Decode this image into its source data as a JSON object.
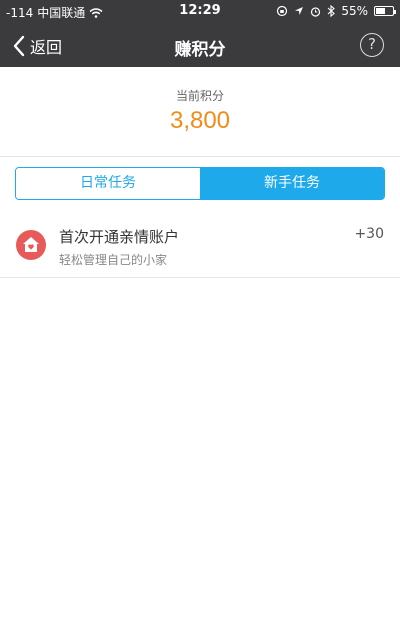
{
  "status_bar": {
    "signal": "-114",
    "carrier": "中国联通",
    "time": "12:29",
    "battery": "55%",
    "battery_level": 0.55
  },
  "nav": {
    "back_label": "返回",
    "title": "赚积分",
    "help_label": "?"
  },
  "points": {
    "label": "当前积分",
    "value": "3,800"
  },
  "tabs": [
    {
      "label": "日常任务",
      "active": false
    },
    {
      "label": "新手任务",
      "active": true
    }
  ],
  "tasks": [
    {
      "title": "首次开通亲情账户",
      "subtitle": "轻松管理自己的小家",
      "reward": "+30",
      "icon": "home-icon"
    }
  ],
  "colors": {
    "accent": "#1da9ea",
    "points": "#f08c1a",
    "task_icon": "#e85a5a",
    "topbar": "#3b3b3d"
  }
}
